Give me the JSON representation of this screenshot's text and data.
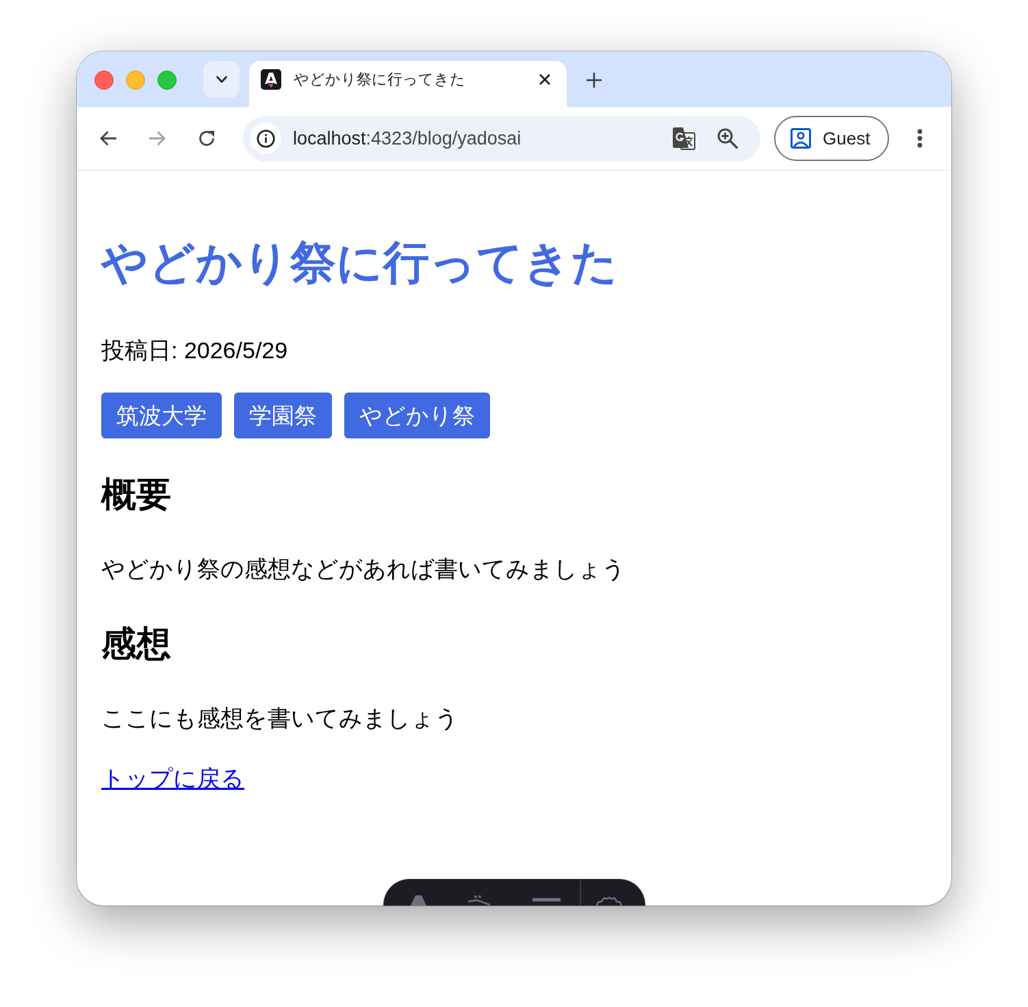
{
  "tab_strip": {
    "tabs": [
      {
        "title": "やどかり祭に行ってきた",
        "selected": true
      }
    ]
  },
  "toolbar": {
    "nav_buttons": [
      {
        "kind": "back",
        "disabled": false
      },
      {
        "kind": "forward",
        "disabled": true
      },
      {
        "kind": "reload",
        "disabled": false
      }
    ],
    "url": {
      "host": "localhost",
      "path": ":4323/blog/yadosai"
    },
    "profile": {
      "label": "Guest"
    }
  },
  "article": {
    "title": "やどかり祭に行ってきた",
    "date": "投稿日: 2026/5/29",
    "tags": [
      "筑波大学",
      "学園祭",
      "やどかり祭"
    ],
    "sections": [
      {
        "heading": "概要",
        "text": "やどかり祭の感想などがあれば書いてみましょう"
      },
      {
        "heading": "感想",
        "text": "ここにも感想を書いてみましょう"
      }
    ],
    "back_link": "トップに戻る"
  }
}
